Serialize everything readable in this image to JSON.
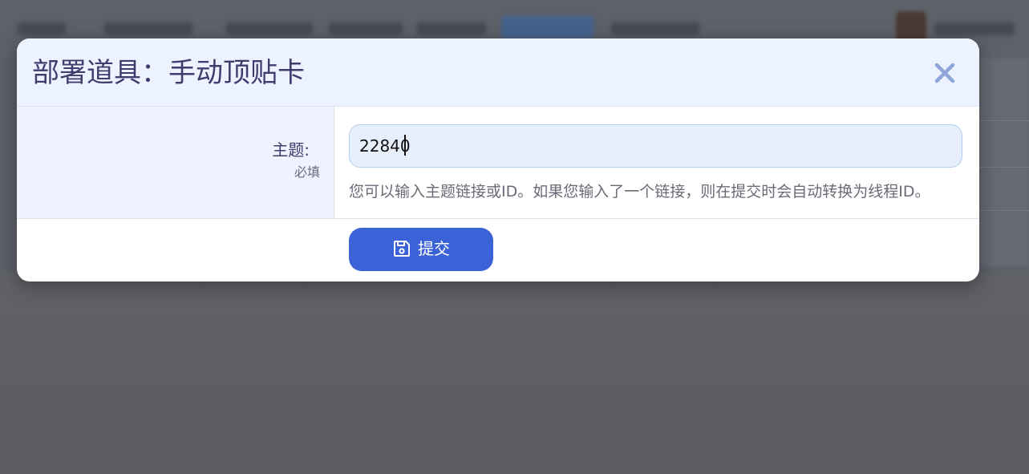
{
  "modal": {
    "title": "部署道具：手动顶贴卡",
    "close_icon": "close-icon"
  },
  "form": {
    "topic": {
      "label": "主题:",
      "required_note": "必填",
      "value": "22840",
      "help": "您可以输入主题链接或ID。如果您输入了一个链接，则在提交时会自动转换为线程ID。"
    },
    "submit": {
      "icon": "save-icon",
      "label": "提交"
    }
  },
  "colors": {
    "overlay": "#5b5e63",
    "header_bg": "#ecf3ff",
    "label_bg": "#eff2ff",
    "input_bg": "#e8effc",
    "accent": "#3b62d6",
    "title_text": "#3f3d6e",
    "close_icon": "#8fa6dc"
  }
}
